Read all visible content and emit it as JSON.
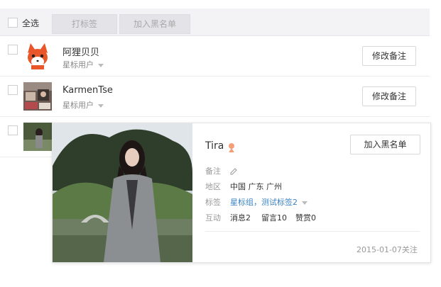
{
  "toolbar": {
    "select_all": "全选",
    "tag_button": "打标签",
    "blacklist_button": "加入黑名单"
  },
  "rows": [
    {
      "name": "阿狸贝贝",
      "tag": "星标用户",
      "action": "修改备注"
    },
    {
      "name": "KarmenTse",
      "tag": "星标用户",
      "action": "修改备注"
    }
  ],
  "card": {
    "name": "Tira",
    "blacklist_button": "加入黑名单",
    "remark_label": "备注",
    "region_label": "地区",
    "region_value": "中国 广东 广州",
    "tags_label": "标签",
    "tags_value": "星标组，测试标签2",
    "interaction_label": "互动",
    "messages": "消息2",
    "comments": "留言10",
    "rewards": "赞赏0",
    "follow_date": "2015-01-07关注"
  },
  "colors": {
    "link_blue": "#3a82c4",
    "toolbar_bg": "#f3f3f5",
    "disabled_btn_bg": "#e4e4e8",
    "fox_orange": "#e8562a"
  }
}
